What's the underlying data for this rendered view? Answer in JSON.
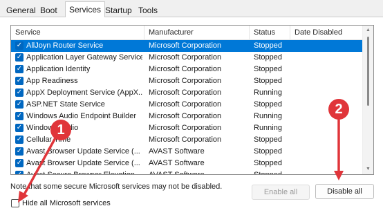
{
  "tabs": [
    {
      "label": "General"
    },
    {
      "label": "Boot"
    },
    {
      "label": "Services",
      "active": true
    },
    {
      "label": "Startup"
    },
    {
      "label": "Tools"
    }
  ],
  "columns": [
    "Service",
    "Manufacturer",
    "Status",
    "Date Disabled"
  ],
  "services": [
    {
      "name": "AllJoyn Router Service",
      "manufacturer": "Microsoft Corporation",
      "status": "Stopped",
      "checked": true,
      "selected": true
    },
    {
      "name": "Application Layer Gateway Service",
      "manufacturer": "Microsoft Corporation",
      "status": "Stopped",
      "checked": true
    },
    {
      "name": "Application Identity",
      "manufacturer": "Microsoft Corporation",
      "status": "Stopped",
      "checked": true
    },
    {
      "name": "App Readiness",
      "manufacturer": "Microsoft Corporation",
      "status": "Stopped",
      "checked": true
    },
    {
      "name": "AppX Deployment Service (AppX...",
      "manufacturer": "Microsoft Corporation",
      "status": "Running",
      "checked": true
    },
    {
      "name": "ASP.NET State Service",
      "manufacturer": "Microsoft Corporation",
      "status": "Stopped",
      "checked": true
    },
    {
      "name": "Windows Audio Endpoint Builder",
      "manufacturer": "Microsoft Corporation",
      "status": "Running",
      "checked": true
    },
    {
      "name": "Windows Audio",
      "manufacturer": "Microsoft Corporation",
      "status": "Running",
      "checked": true
    },
    {
      "name": "Cellular Time",
      "manufacturer": "Microsoft Corporation",
      "status": "Stopped",
      "checked": true
    },
    {
      "name": "Avast Browser Update Service (...",
      "manufacturer": "AVAST Software",
      "status": "Stopped",
      "checked": true
    },
    {
      "name": "Avast Browser Update Service (...",
      "manufacturer": "AVAST Software",
      "status": "Stopped",
      "checked": true
    },
    {
      "name": "Avast Secure Browser Elevation ...",
      "manufacturer": "AVAST Software",
      "status": "Stopped",
      "checked": true
    }
  ],
  "note": "Note that some secure Microsoft services may not be disabled.",
  "buttons": {
    "enable_all": "Enable all",
    "disable_all": "Disable all"
  },
  "hide_ms": {
    "label": "Hide all Microsoft services",
    "checked": false
  },
  "annotations": {
    "badge1": "1",
    "badge2": "2",
    "color": "#e0353a"
  },
  "colors": {
    "selection": "#0078d7",
    "checkbox": "#0067c0"
  },
  "icons": {
    "checkbox_mark": "✓",
    "scroll_up": "▲",
    "scroll_down": "▼"
  }
}
